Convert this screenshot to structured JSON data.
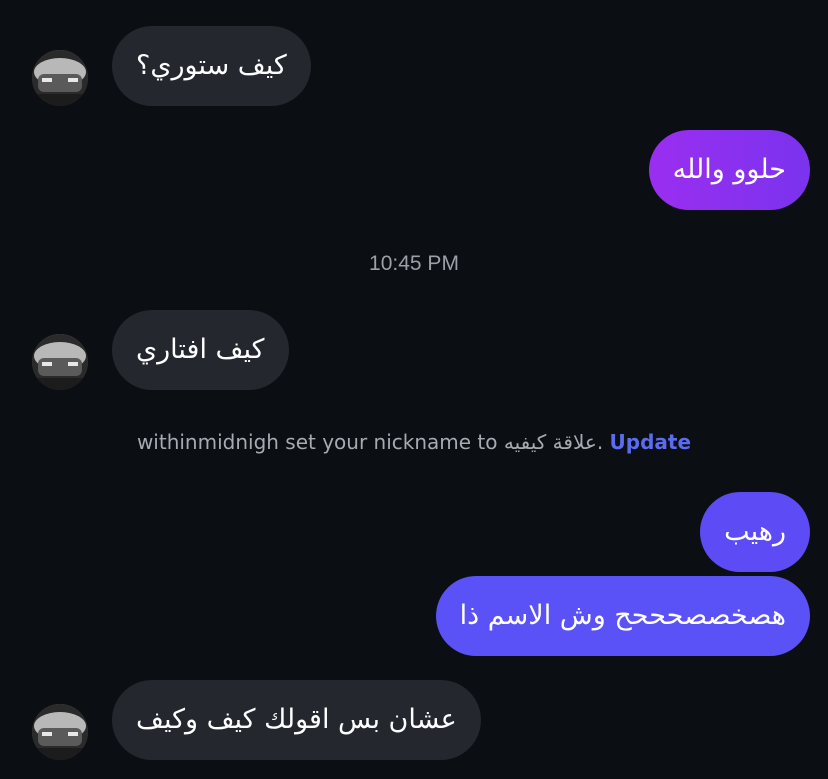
{
  "messages": {
    "m1": "كيف ستوري؟",
    "m2": "حلوو والله",
    "m3": "كيف افتاري",
    "m4": "رهيب",
    "m5": "هصخصصحححح وش الاسم ذا",
    "m6": "عشان بس اقولك كيف وكيف"
  },
  "timestamp": "10:45 PM",
  "system_note": {
    "text": "withinmidnigh set your nickname to علاقة كيفيه.",
    "link_label": "Update"
  },
  "colors": {
    "background": "#0b0e12",
    "incoming_bubble": "#24272d",
    "outgoing_purple": "#8a2ff0",
    "outgoing_indigo": "#5b4ff5",
    "link": "#5b6cf0"
  },
  "icons": {
    "avatar": "profile-photo-car"
  }
}
